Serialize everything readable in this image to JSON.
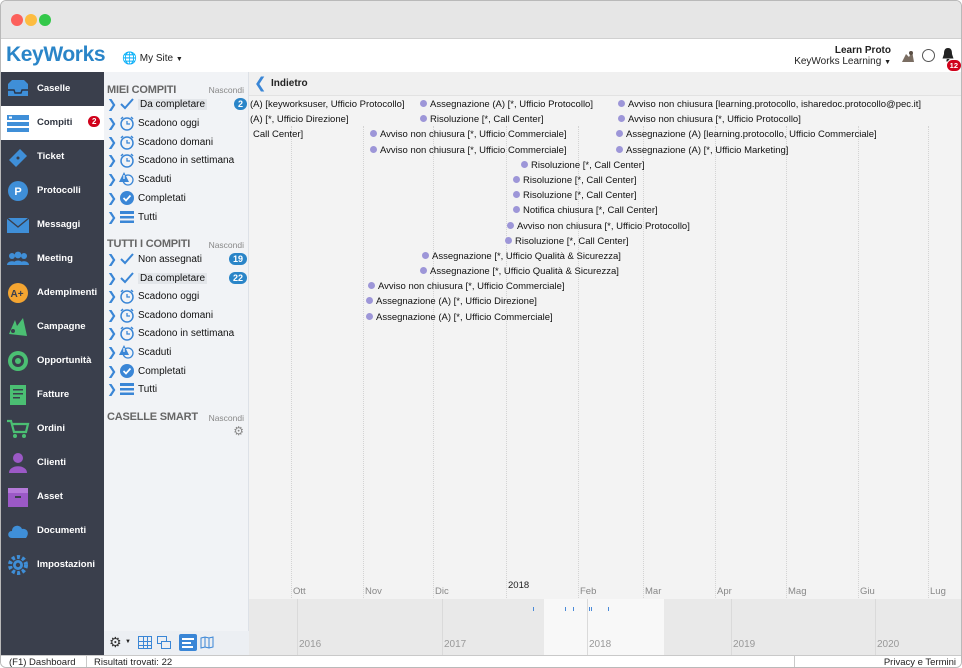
{
  "app": {
    "logo": "KeyWorks",
    "site_label": "My Site"
  },
  "user": {
    "name": "Learn Proto",
    "org": "KeyWorks Learning",
    "notifications": "12"
  },
  "sidebar": {
    "items": [
      {
        "label": "Caselle",
        "icon": "inbox-icon"
      },
      {
        "label": "Compiti",
        "icon": "tasks-icon",
        "badge": "2",
        "active": true
      },
      {
        "label": "Ticket",
        "icon": "ticket-icon"
      },
      {
        "label": "Protocolli",
        "icon": "protocol-icon"
      },
      {
        "label": "Messaggi",
        "icon": "mail-icon"
      },
      {
        "label": "Meeting",
        "icon": "people-icon"
      },
      {
        "label": "Adempimenti",
        "icon": "compliance-icon"
      },
      {
        "label": "Campagne",
        "icon": "campaign-icon"
      },
      {
        "label": "Opportunità",
        "icon": "target-icon"
      },
      {
        "label": "Fatture",
        "icon": "invoice-icon"
      },
      {
        "label": "Ordini",
        "icon": "cart-icon"
      },
      {
        "label": "Clienti",
        "icon": "person-icon"
      },
      {
        "label": "Asset",
        "icon": "box-icon"
      },
      {
        "label": "Documenti",
        "icon": "cloud-icon"
      },
      {
        "label": "Impostazioni",
        "icon": "gear-icon"
      }
    ]
  },
  "tasks": {
    "my": {
      "title": "MIEI COMPITI",
      "hide": "Nascondi",
      "items": [
        {
          "label": "Da completare",
          "icon": "check",
          "badge": "2",
          "selected": true
        },
        {
          "label": "Scadono oggi",
          "icon": "clock"
        },
        {
          "label": "Scadono domani",
          "icon": "clock"
        },
        {
          "label": "Scadono in settimana",
          "icon": "clock"
        },
        {
          "label": "Scaduti",
          "icon": "warning"
        },
        {
          "label": "Completati",
          "icon": "check-circle"
        },
        {
          "label": "Tutti",
          "icon": "list"
        }
      ]
    },
    "all": {
      "title": "TUTTI I COMPITI",
      "hide": "Nascondi",
      "items": [
        {
          "label": "Non assegnati",
          "icon": "check",
          "badge": "19"
        },
        {
          "label": "Da completare",
          "icon": "check",
          "badge": "22",
          "selected": true
        },
        {
          "label": "Scadono oggi",
          "icon": "clock"
        },
        {
          "label": "Scadono domani",
          "icon": "clock"
        },
        {
          "label": "Scadono in settimana",
          "icon": "clock"
        },
        {
          "label": "Scaduti",
          "icon": "warning"
        },
        {
          "label": "Completati",
          "icon": "check-circle"
        },
        {
          "label": "Tutti",
          "icon": "list"
        }
      ]
    },
    "smart": {
      "title": "CASELLE SMART",
      "hide": "Nascondi"
    }
  },
  "main": {
    "back": "Indietro",
    "events": [
      {
        "text": "(A) [keyworksuser, Ufficio Protocollo]",
        "dot": false
      },
      {
        "text": "(A) [*, Ufficio Direzione]",
        "dot": false
      },
      {
        "text": "Call Center]",
        "dot": false
      },
      {
        "text": "Assegnazione (A) [*, Ufficio Protocollo]",
        "dot": true
      },
      {
        "text": "Risoluzione [*, Call Center]",
        "dot": true
      },
      {
        "text": "Avviso non chiusura [*, Ufficio Commerciale]",
        "dot": true
      },
      {
        "text": "Avviso non chiusura [*, Ufficio Commerciale]",
        "dot": true
      },
      {
        "text": "Avviso non chiusura [learning.protocollo, isharedoc.protocollo@pec.it]",
        "dot": true
      },
      {
        "text": "Avviso non chiusura [*, Ufficio Protocollo]",
        "dot": true
      },
      {
        "text": "Assegnazione (A) [learning.protocollo, Ufficio Commerciale]",
        "dot": true
      },
      {
        "text": "Assegnazione (A) [*, Ufficio Marketing]",
        "dot": true
      },
      {
        "text": "Risoluzione [*, Call Center]",
        "dot": true
      },
      {
        "text": "Risoluzione [*, Call Center]",
        "dot": true
      },
      {
        "text": "Risoluzione [*, Call Center]",
        "dot": true
      },
      {
        "text": "Notifica chiusura [*, Call Center]",
        "dot": true
      },
      {
        "text": "Avviso non chiusura [*, Ufficio Protocollo]",
        "dot": true
      },
      {
        "text": "Risoluzione [*, Call Center]",
        "dot": true
      },
      {
        "text": "Assegnazione [*, Ufficio Qualità & Sicurezza]",
        "dot": true
      },
      {
        "text": "Assegnazione [*, Ufficio Qualità & Sicurezza]",
        "dot": true
      },
      {
        "text": "Avviso non chiusura [*, Ufficio Commerciale]",
        "dot": true
      },
      {
        "text": "Assegnazione (A) [*, Ufficio Direzione]",
        "dot": true
      },
      {
        "text": "Assegnazione (A) [*, Ufficio Commerciale]",
        "dot": true
      }
    ],
    "year_label": "2018",
    "months": [
      "Ott",
      "Nov",
      "Dic",
      "Feb",
      "Mar",
      "Apr",
      "Mag",
      "Giu",
      "Lug"
    ],
    "overview_years": [
      "2016",
      "2017",
      "2018",
      "2019",
      "2020"
    ]
  },
  "status": {
    "shortcut": "(F1) Dashboard",
    "results": "Risultati trovati: 22",
    "privacy": "Privacy e Termini"
  }
}
